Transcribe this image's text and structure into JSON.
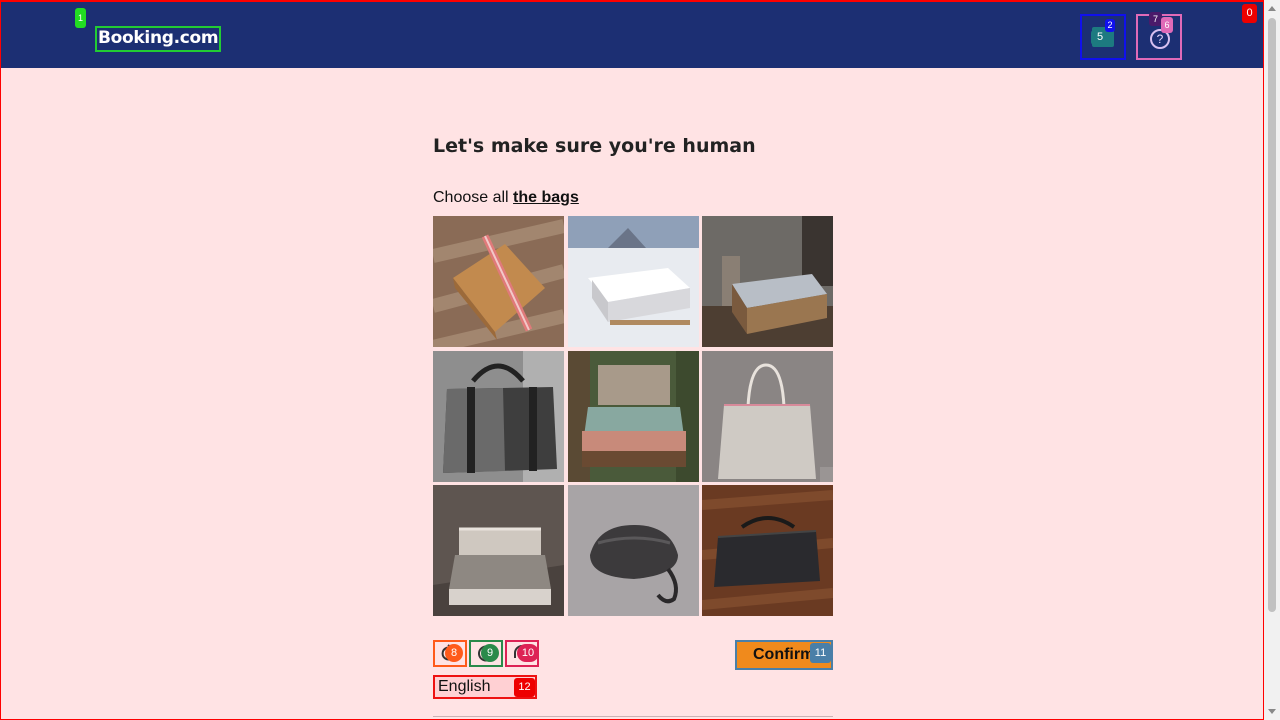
{
  "header": {
    "logo_text": "Booking.com",
    "currency_icon": "currency-flag-icon",
    "help_icon": "question-circle-icon",
    "help_glyph": "?",
    "bg_color": "#1c2f73"
  },
  "captcha": {
    "title": "Let's make sure you're human",
    "instruction_prefix": "Choose all ",
    "instruction_target": "the bags",
    "tiles": [
      {
        "subject": "paper-bag"
      },
      {
        "subject": "bed-in-snow"
      },
      {
        "subject": "bed-forest"
      },
      {
        "subject": "duffel-bag"
      },
      {
        "subject": "bed-in-woods"
      },
      {
        "subject": "tote-bag"
      },
      {
        "subject": "bed-frame"
      },
      {
        "subject": "gray-pouch"
      },
      {
        "subject": "dark-bag-on-floor"
      }
    ],
    "confirm_label": "Confirm",
    "refresh_icon": "refresh-icon",
    "info_icon": "info-icon",
    "audio_icon": "headphones-icon",
    "language": "English",
    "accent_color": "#f08a1c"
  },
  "markers": {
    "m0": "0",
    "m1": "1",
    "m2": "2",
    "m5": "5",
    "m6": "6",
    "m7": "7",
    "m8": "8",
    "m9": "9",
    "m10": "10",
    "m11": "11",
    "m12": "12"
  }
}
